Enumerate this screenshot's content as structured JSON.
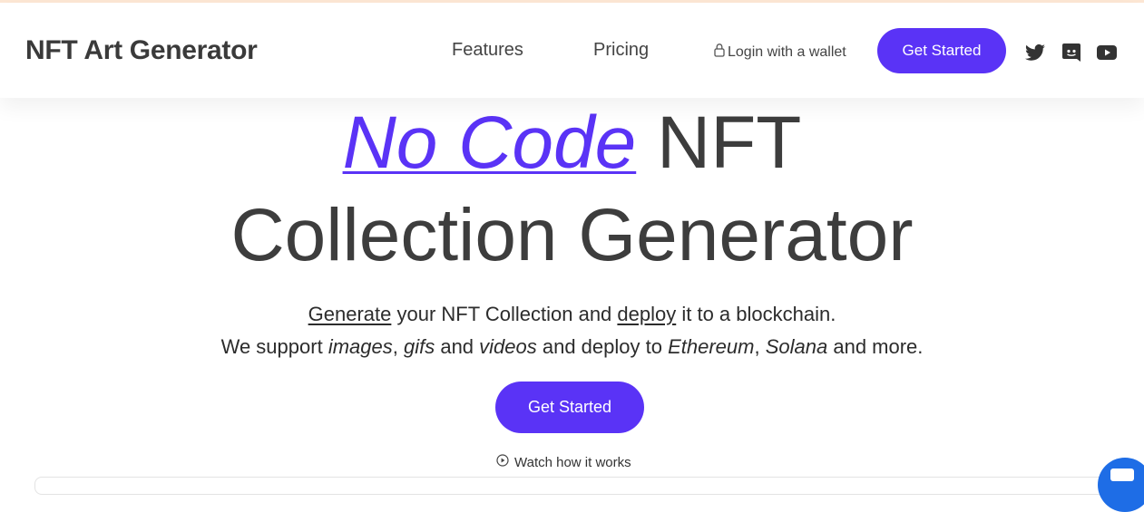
{
  "brand": "NFT Art Generator",
  "nav": {
    "features": "Features",
    "pricing": "Pricing",
    "login": "Login with a wallet",
    "cta": "Get Started",
    "social_icons": [
      "twitter-icon",
      "discord-icon",
      "youtube-icon"
    ]
  },
  "hero": {
    "accent": "No Code",
    "title_rest": " NFT",
    "title_line2": "Collection Generator",
    "sub1": {
      "generate": "Generate",
      "t1": " your NFT Collection and ",
      "deploy": "deploy",
      "t2": " it to a blockchain."
    },
    "sub2": {
      "t1": "We support ",
      "images": "images",
      "t2": ", ",
      "gifs": "gifs",
      "t3": " and ",
      "videos": "videos",
      "t4": " and deploy to ",
      "ethereum": "Ethereum",
      "t5": ", ",
      "solana": "Solana",
      "t6": " and more."
    },
    "cta": "Get Started",
    "watch": "Watch how it works"
  },
  "colors": {
    "accent": "#5a33f6",
    "text": "#3d3d3d",
    "chat": "#1e6de6"
  }
}
